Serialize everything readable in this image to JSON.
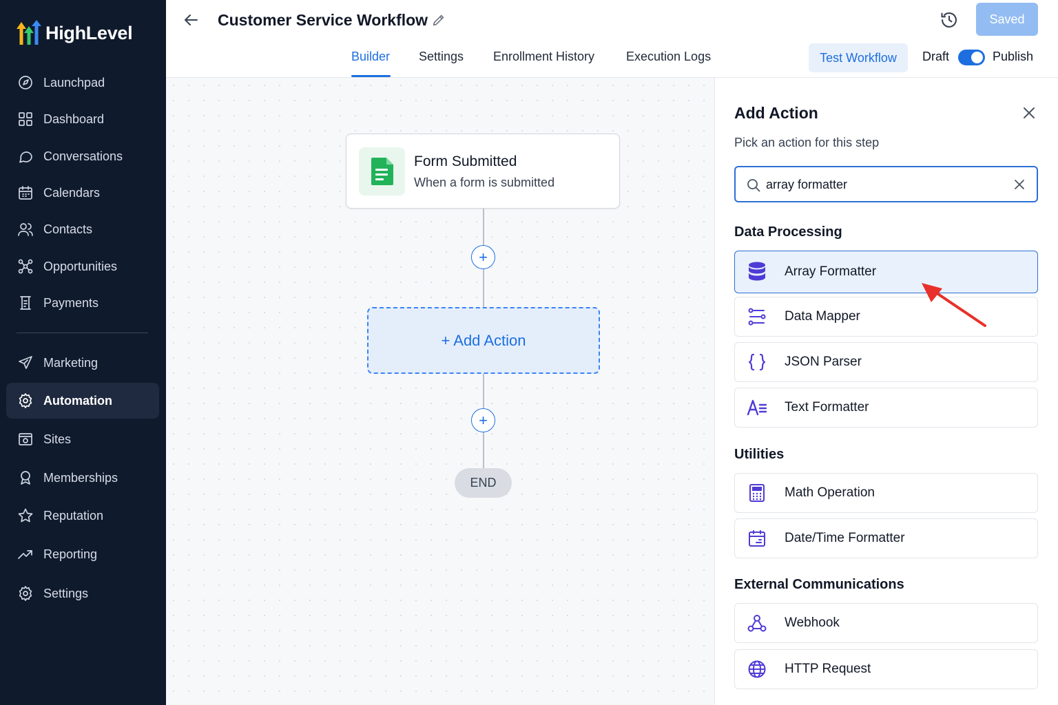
{
  "brand": {
    "name": "HighLevel"
  },
  "sidebar": {
    "items": [
      {
        "label": "Launchpad",
        "icon": "launchpad-icon"
      },
      {
        "label": "Dashboard",
        "icon": "dashboard-icon"
      },
      {
        "label": "Conversations",
        "icon": "chat-bubble-icon"
      },
      {
        "label": "Calendars",
        "icon": "calendar-icon"
      },
      {
        "label": "Contacts",
        "icon": "contacts-icon"
      },
      {
        "label": "Opportunities",
        "icon": "opportunities-icon"
      },
      {
        "label": "Payments",
        "icon": "payments-icon"
      },
      {
        "label": "Marketing",
        "icon": "paper-plane-icon"
      },
      {
        "label": "Automation",
        "icon": "gear-icon",
        "active": true
      },
      {
        "label": "Sites",
        "icon": "sites-icon"
      },
      {
        "label": "Memberships",
        "icon": "memberships-icon"
      },
      {
        "label": "Reputation",
        "icon": "star-icon"
      },
      {
        "label": "Reporting",
        "icon": "trend-icon"
      },
      {
        "label": "Settings",
        "icon": "gear-icon"
      }
    ]
  },
  "header": {
    "title": "Customer Service Workflow",
    "saved_label": "Saved",
    "tabs": [
      "Builder",
      "Settings",
      "Enrollment History",
      "Execution Logs"
    ],
    "active_tab": "Builder",
    "test_label": "Test Workflow",
    "draft_label": "Draft",
    "publish_label": "Publish",
    "publish_toggle_on": true
  },
  "canvas": {
    "trigger": {
      "title": "Form Submitted",
      "subtitle": "When a form is submitted"
    },
    "add_action_label": "+ Add Action",
    "end_label": "END"
  },
  "panel": {
    "title": "Add Action",
    "subtitle": "Pick an action for this step",
    "search_value": "array formatter",
    "sections": [
      {
        "title": "Data Processing",
        "items": [
          {
            "label": "Array Formatter",
            "icon": "database-icon",
            "selected": true
          },
          {
            "label": "Data Mapper",
            "icon": "data-mapper-icon"
          },
          {
            "label": "JSON Parser",
            "icon": "braces-icon"
          },
          {
            "label": "Text Formatter",
            "icon": "text-format-icon"
          }
        ]
      },
      {
        "title": "Utilities",
        "items": [
          {
            "label": "Math Operation",
            "icon": "calculator-icon"
          },
          {
            "label": "Date/Time Formatter",
            "icon": "calendar-icon"
          }
        ]
      },
      {
        "title": "External Communications",
        "items": [
          {
            "label": "Webhook",
            "icon": "webhook-icon"
          },
          {
            "label": "HTTP Request",
            "icon": "globe-icon"
          }
        ]
      }
    ]
  },
  "colors": {
    "accent": "#1d6fe0",
    "sidebar_bg": "#0f1a2c",
    "annotation_arrow": "#e8312a",
    "icon_purple": "#4f3bd6"
  }
}
